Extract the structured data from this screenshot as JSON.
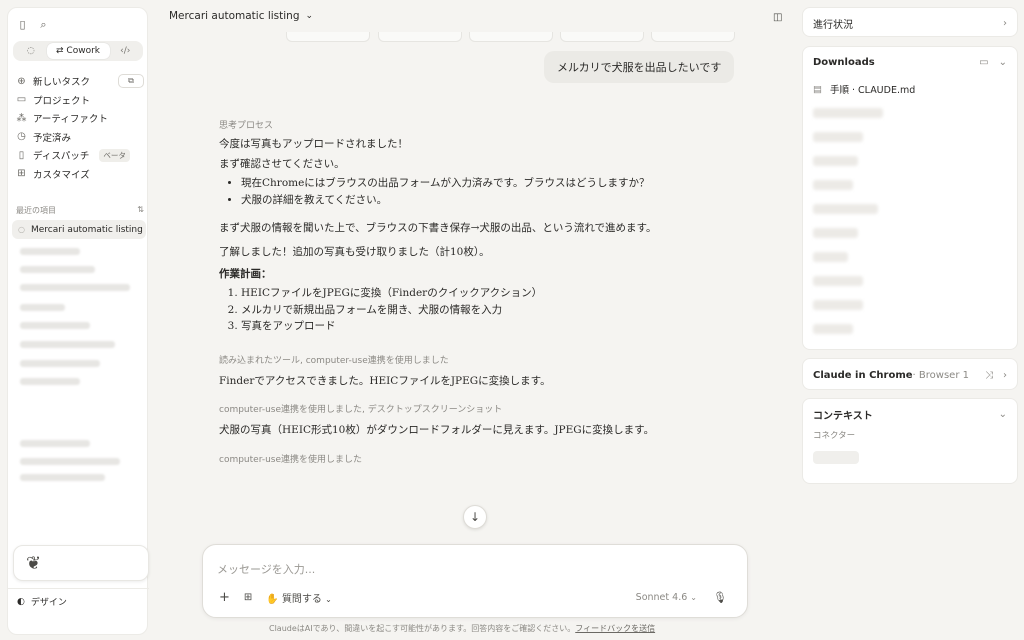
{
  "sidebar": {
    "tabs": [
      "Cowork"
    ],
    "nav": [
      {
        "label": "新しいタスク",
        "icon": "plus-icon"
      },
      {
        "label": "プロジェクト",
        "icon": "folder-icon"
      },
      {
        "label": "アーティファクト",
        "icon": "artifact-icon"
      },
      {
        "label": "予定済み",
        "icon": "clock-icon"
      },
      {
        "label": "ディスパッチ",
        "icon": "dispatch-icon",
        "badge": "ベータ"
      },
      {
        "label": "カスタマイズ",
        "icon": "customize-icon"
      }
    ],
    "recent_heading": "最近の項目",
    "recent_active": "Mercari automatic listing",
    "design_label": "デザイン"
  },
  "header": {
    "title": "Mercari automatic listing"
  },
  "chat": {
    "user_message": "メルカリで犬服を出品したいです",
    "thinking_label": "思考プロセス",
    "lines": [
      "今度は写真もアップロードされました！",
      "まず確認させてください。"
    ],
    "bullets": [
      "現在Chromeにはブラウスの出品フォームが入力済みです。ブラウスはどうしますか？",
      "犬服の詳細を教えてください。"
    ],
    "para2": "まず犬服の情報を聞いた上で、ブラウスの下書き保存→犬服の出品、という流れで進めます。",
    "para3": "了解しました！追加の写真も受け取りました（計10枚）。",
    "plan_heading": "作業計画：",
    "plan": [
      "HEICファイルをJPEGに変換（Finderのクイックアクション）",
      "メルカリで新規出品フォームを開き、犬服の情報を入力",
      "写真をアップロード"
    ],
    "meta1": "読み込まれたツール, computer-use連携を使用しました",
    "msg1": "Finderでアクセスできました。HEICファイルをJPEGに変換します。",
    "meta2": "computer-use連携を使用しました, デスクトップスクリーンショット",
    "msg2": "犬服の写真（HEIC形式10枚）がダウンロードフォルダーに見えます。JPEGに変換します。",
    "meta3": "computer-use連携を使用しました"
  },
  "composer": {
    "placeholder": "メッセージを入力...",
    "question_label": "質問する",
    "model": "Sonnet 4.6"
  },
  "footer": {
    "text": "ClaudeはAIであり、間違いを起こす可能性があります。回答内容をご確認ください。",
    "link": "フィードバックを送信"
  },
  "right": {
    "progress_title": "進行状況",
    "downloads_title": "Downloads",
    "downloads_first": "手順 · CLAUDE.md",
    "chrome_title": "Claude in Chrome",
    "chrome_sub": "· Browser 1",
    "context_title": "コンテキスト",
    "connector_label": "コネクター"
  }
}
